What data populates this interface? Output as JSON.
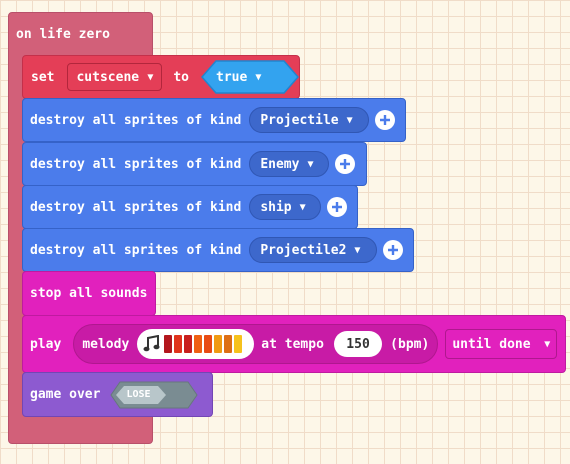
{
  "event": {
    "label": "on life zero"
  },
  "set_block": {
    "label": "set",
    "variable": "cutscene",
    "to_label": "to",
    "value": "true"
  },
  "destroy_blocks": [
    {
      "label": "destroy all sprites of kind",
      "kind": "Projectile"
    },
    {
      "label": "destroy all sprites of kind",
      "kind": "Enemy"
    },
    {
      "label": "destroy all sprites of kind",
      "kind": "ship"
    },
    {
      "label": "destroy all sprites of kind",
      "kind": "Projectile2"
    }
  ],
  "stop_block": {
    "label": "stop all sounds"
  },
  "play_block": {
    "label": "play",
    "melody_label": "melody",
    "at_tempo_label": "at tempo",
    "tempo": "150",
    "unit": "(bpm)",
    "mode": "until done",
    "melody_colors": [
      "#b3161d",
      "#e0331c",
      "#c81f1d",
      "#ef5f12",
      "#e84b14",
      "#f09a13",
      "#dd6f15",
      "#f6c21c"
    ]
  },
  "game_over_block": {
    "label": "game over",
    "result": "LOSE"
  },
  "colors": {
    "event": "#d26079",
    "variables": "#e43e57",
    "sprites": "#4b7ceb",
    "music": "#e121bd",
    "game": "#8d5ad0",
    "bool": "#33a3ef"
  }
}
